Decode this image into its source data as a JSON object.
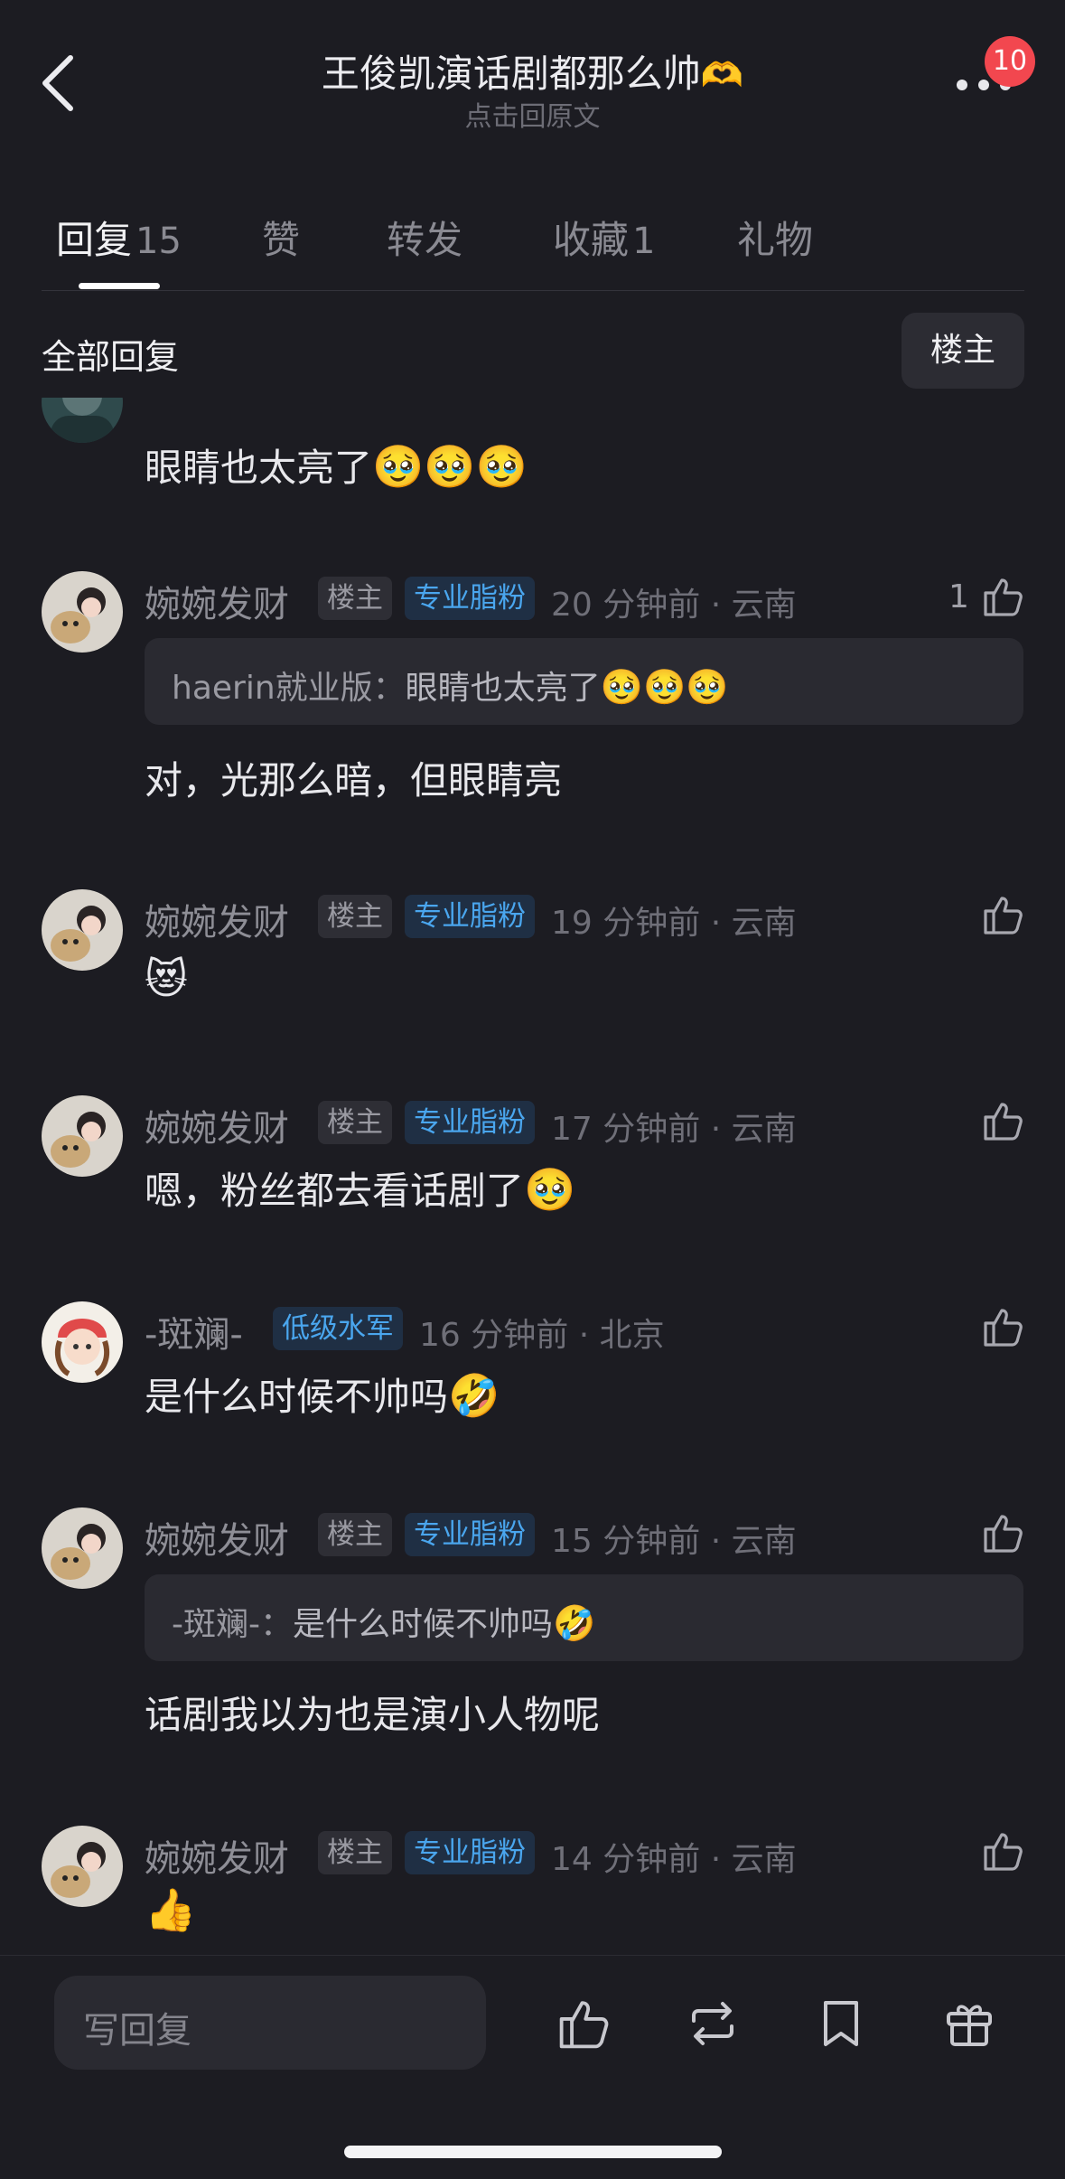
{
  "header": {
    "title": "王俊凯演话剧都那么帅",
    "title_emoji": "🫶",
    "subtitle": "点击回原文",
    "badge_count": "10"
  },
  "tabs": [
    {
      "label": "回复",
      "count": "15"
    },
    {
      "label": "赞",
      "count": ""
    },
    {
      "label": "转发",
      "count": ""
    },
    {
      "label": "收藏",
      "count": "1"
    },
    {
      "label": "礼物",
      "count": ""
    }
  ],
  "filter": {
    "label": "全部回复",
    "owner_button": "楼主"
  },
  "comments": [
    {
      "body": "眼睛也太亮了",
      "body_emoji": "🥹🥹🥹"
    },
    {
      "username": "婉婉发财",
      "owner_tag": "楼主",
      "fan_tag": "专业脂粉",
      "time": "20 分钟前 · 云南",
      "likes": "1",
      "quote_name": "haerin就业版：",
      "quote_text": "眼睛也太亮了",
      "quote_emoji": "🥹🥹🥹",
      "body": "对，光那么暗，但眼睛亮",
      "body_emoji": ""
    },
    {
      "username": "婉婉发财",
      "owner_tag": "楼主",
      "fan_tag": "专业脂粉",
      "time": "19 分钟前 · 云南",
      "likes": "",
      "body": "",
      "body_emoji": "😻"
    },
    {
      "username": "婉婉发财",
      "owner_tag": "楼主",
      "fan_tag": "专业脂粉",
      "time": "17 分钟前 · 云南",
      "likes": "",
      "body": "嗯，粉丝都去看话剧了",
      "body_emoji": "🥹"
    },
    {
      "username": "-斑斓-",
      "level_tag": "低级水军",
      "time": "16 分钟前 · 北京",
      "likes": "",
      "body": "是什么时候不帅吗",
      "body_emoji": "🤣"
    },
    {
      "username": "婉婉发财",
      "owner_tag": "楼主",
      "fan_tag": "专业脂粉",
      "time": "15 分钟前 · 云南",
      "likes": "",
      "quote_name": "-斑斓-：",
      "quote_text": "是什么时候不帅吗",
      "quote_emoji": "🤣",
      "body": "话剧我以为也是演小人物呢",
      "body_emoji": ""
    },
    {
      "username": "婉婉发财",
      "owner_tag": "楼主",
      "fan_tag": "专业脂粉",
      "time": "14 分钟前 · 云南",
      "likes": "",
      "body": "",
      "body_emoji": "👍"
    }
  ],
  "bottom_bar": {
    "reply_placeholder": "写回复",
    "icons": [
      "thumbs-up-icon",
      "repost-icon",
      "bookmark-icon",
      "gift-icon"
    ]
  },
  "colors": {
    "background": "#1c1c22",
    "badge": "#f2474f",
    "fan_tag_text": "#4aa6ee"
  }
}
